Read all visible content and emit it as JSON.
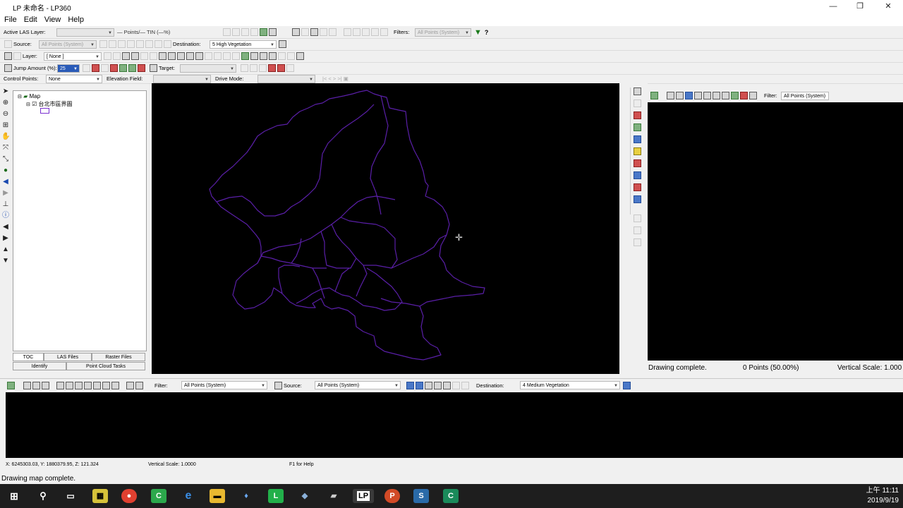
{
  "window": {
    "app_icon": "LP",
    "title": "LP 未命名 - LP360",
    "minimize": "—",
    "maximize": "❐",
    "close": "✕"
  },
  "menu": [
    "File",
    "Edit",
    "View",
    "Help"
  ],
  "toolbar1": {
    "active_las_label": "Active LAS Layer:",
    "points_tin": "— Points/— TIN (—%)",
    "filters_label": "Filters:",
    "filters_value": "All Points (System)"
  },
  "toolbar2": {
    "source_label": "Source:",
    "source_value": "All Points (System)",
    "destination_label": "Destination:",
    "destination_value": "5  High Vegetation"
  },
  "toolbar3": {
    "layer_label": "Layer:",
    "layer_value": "[ None ]"
  },
  "toolbar4": {
    "jump_label": "Jump Amount (%):",
    "jump_value": "25",
    "target_label": "Target:"
  },
  "toolbar5": {
    "control_label": "Control Points:",
    "control_value": "None",
    "elevation_label": "Elevation Field:",
    "drive_label": "Drive Mode:"
  },
  "toc": {
    "root": "Map",
    "layer": "台北市區界圖"
  },
  "toc_tabs_row1": [
    "TOC",
    "LAS Files",
    "Raster Files"
  ],
  "toc_tabs_row2": [
    "Identify",
    "Point Cloud Tasks"
  ],
  "right_panel": {
    "filter_label": "Filter:",
    "filter_value": "All Points (System)",
    "status": "Drawing complete.",
    "points": "0 Points (50.00%)",
    "vscale": "Vertical Scale: 1.000"
  },
  "bottom_toolbar": {
    "filter_label": "Filter:",
    "filter_value": "All Points (System)",
    "source_label": "Source:",
    "source_value": "All Points (System)",
    "destination_label": "Destination:",
    "destination_value": "4  Medium Vegetation"
  },
  "coords": {
    "xy": "X: 6245303.03, Y: 1880379.95, Z: 121.324",
    "vscale": "Vertical Scale: 1.0000",
    "help": "F1 for Help"
  },
  "status": "Drawing map complete.",
  "taskbar": {
    "time": "上午 11:11",
    "date": "2019/9/19"
  },
  "colors": {
    "boundary": "#5a1fa8",
    "map_bg": "#000000"
  }
}
